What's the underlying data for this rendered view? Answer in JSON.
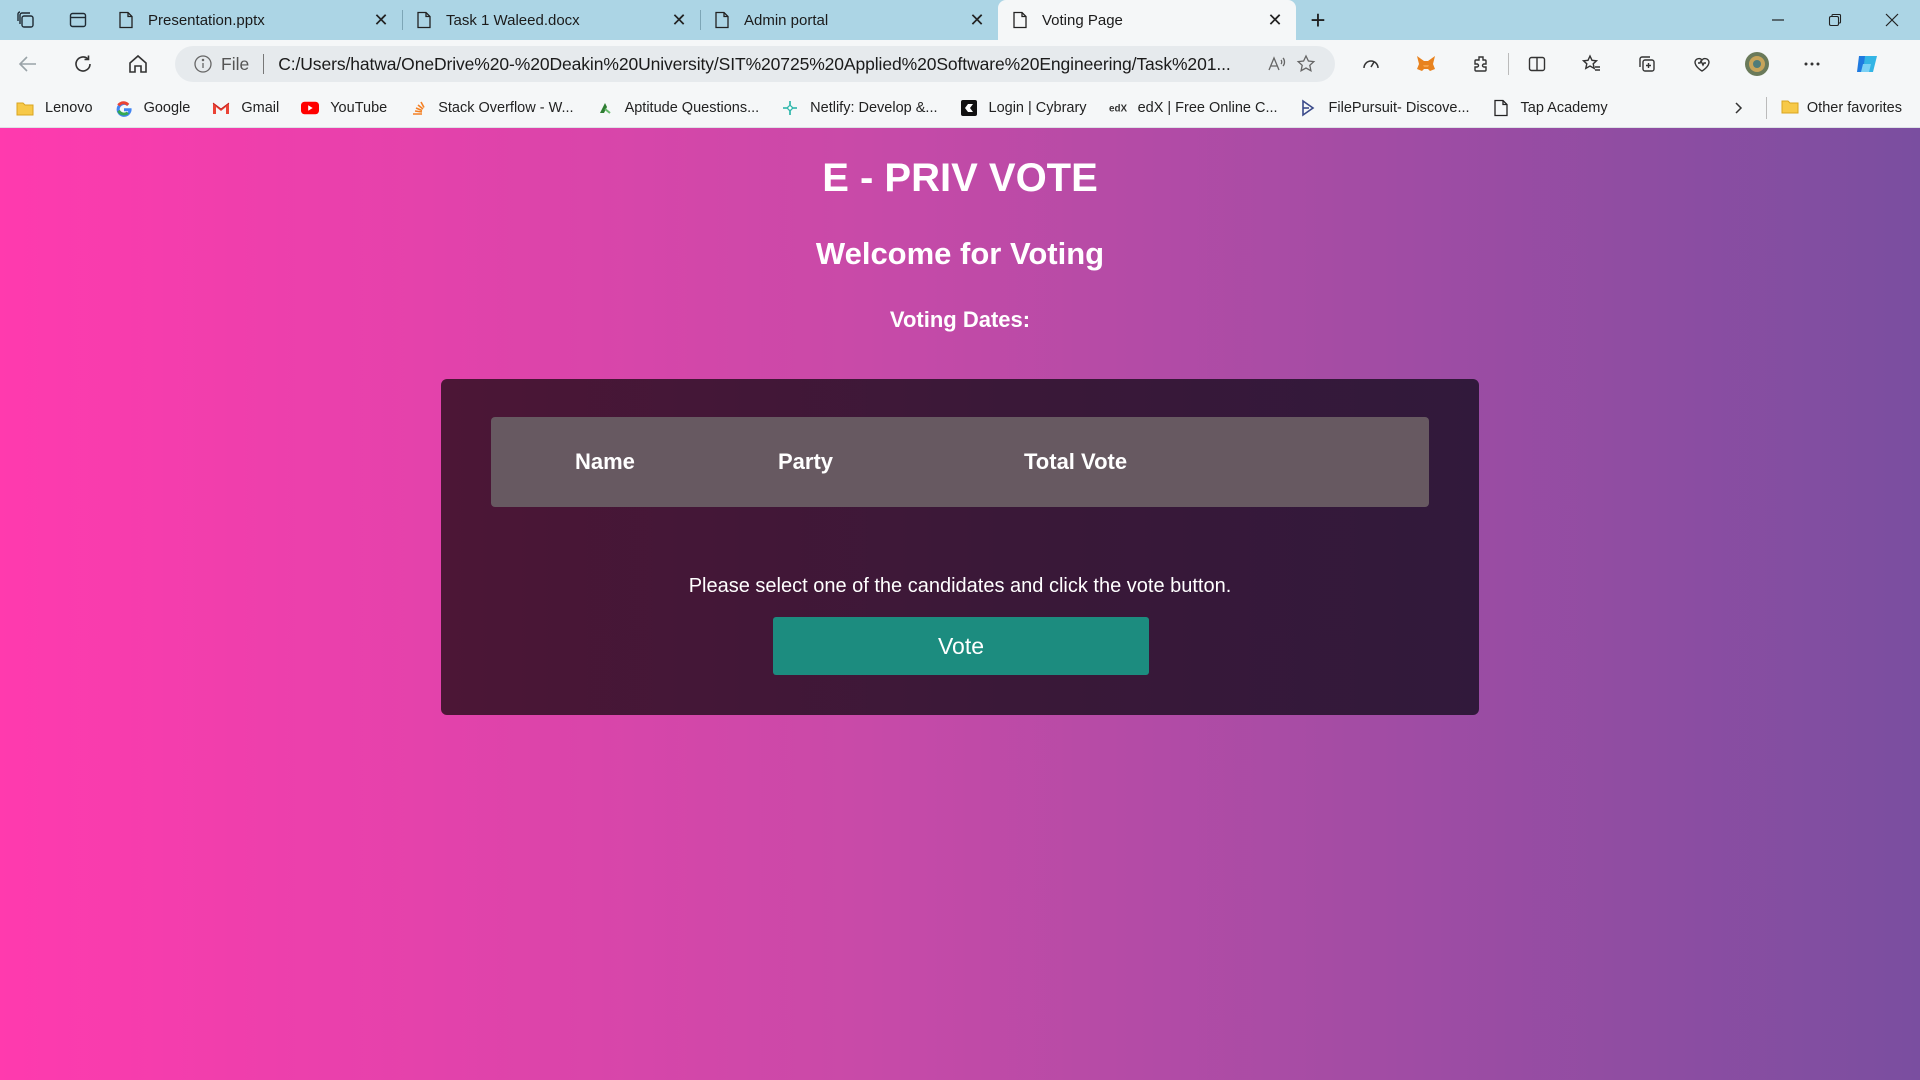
{
  "browser": {
    "tabs": [
      {
        "title": "Presentation.pptx"
      },
      {
        "title": "Task 1 Waleed.docx"
      },
      {
        "title": "Admin portal"
      },
      {
        "title": "Voting Page"
      }
    ],
    "address": {
      "file_label": "File",
      "url": "C:/Users/hatwa/OneDrive%20-%20Deakin%20University/SIT%20725%20Applied%20Software%20Engineering/Task%201..."
    },
    "bookmarks": [
      {
        "label": "Lenovo"
      },
      {
        "label": "Google"
      },
      {
        "label": "Gmail"
      },
      {
        "label": "YouTube"
      },
      {
        "label": "Stack Overflow - W..."
      },
      {
        "label": "Aptitude Questions..."
      },
      {
        "label": "Netlify: Develop &..."
      },
      {
        "label": "Login | Cybrary"
      },
      {
        "label": "edX | Free Online C..."
      },
      {
        "label": "FilePursuit- Discove..."
      },
      {
        "label": "Tap Academy"
      }
    ],
    "other_favorites": "Other favorites"
  },
  "page": {
    "title": "E - PRIV VOTE",
    "welcome": "Welcome for Voting",
    "voting_dates_label": "Voting Dates:",
    "table_headers": {
      "name": "Name",
      "party": "Party",
      "total_vote": "Total Vote"
    },
    "instruction": "Please select one of the candidates and click the vote button.",
    "vote_button": "Vote"
  },
  "colors": {
    "gradient_start": "#ff3aae",
    "gradient_end": "#7a4ea0",
    "panel": "#3d1838",
    "table_header": "#675961",
    "vote_button": "#1c8c7f",
    "tabbar": "#acd5e5"
  }
}
